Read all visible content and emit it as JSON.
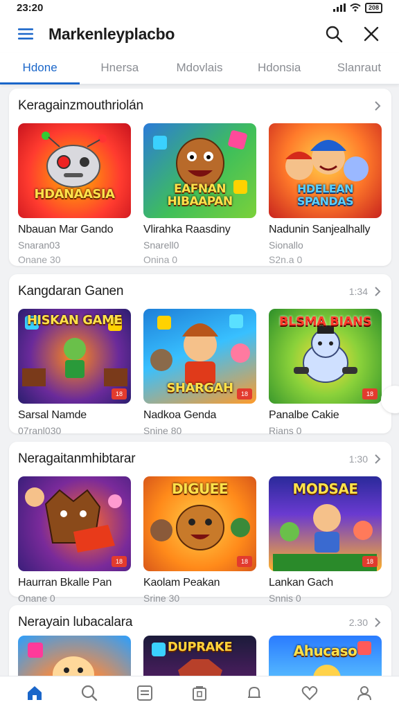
{
  "status": {
    "time": "23:20",
    "battery": "208"
  },
  "app": {
    "title": "Markenleyplacbo"
  },
  "tabs": [
    {
      "label": "Hdone",
      "active": true
    },
    {
      "label": "Hnersa",
      "active": false
    },
    {
      "label": "Mdovlais",
      "active": false
    },
    {
      "label": "Hdonsia",
      "active": false
    },
    {
      "label": "Slanraut",
      "active": false
    }
  ],
  "sections": [
    {
      "title": "Keragainzmouthriolán",
      "count": "",
      "items": [
        {
          "thumb_text": "HDANAASIA",
          "name": "Nbauan Mar Gando",
          "sub": "Snaran03",
          "meta": "Onane 30",
          "colors": [
            "#ff3b2f",
            "#ffb400"
          ]
        },
        {
          "thumb_text": "EAFNAN HIBAAPAN",
          "name": "Vlirahka Raasdiny",
          "sub": "Snarell0",
          "meta": "Onina 0",
          "colors": [
            "#2b7bd8",
            "#7bd13a"
          ]
        },
        {
          "thumb_text": "HDELEAN SPANDAS",
          "name": "Nadunin Sanjealhally",
          "sub": "Sionallo",
          "meta": "S2n.a 0",
          "colors": [
            "#ff5a2a",
            "#ffd24a"
          ]
        }
      ]
    },
    {
      "title": "Kangdaran Ganen",
      "count": "1:34",
      "items": [
        {
          "thumb_text": "HISKAN GAME",
          "name": "Sarsal Namde",
          "sub": "07ranl030",
          "meta": "",
          "colors": [
            "#2a1e6e",
            "#ff8a1a"
          ]
        },
        {
          "thumb_text": "SHARGAH",
          "name": "Nadkoa Genda",
          "sub": "Snine 80",
          "meta": "",
          "colors": [
            "#1e7fd8",
            "#ff9b2a"
          ]
        },
        {
          "thumb_text": "BLSMA BIANS",
          "name": "Panalbe Cakie",
          "sub": "Rians 0",
          "meta": "",
          "colors": [
            "#2d8f2a",
            "#ffde3a"
          ]
        }
      ]
    },
    {
      "title": "Neragaitanmhibtarar",
      "count": "1:30",
      "items": [
        {
          "thumb_text": "",
          "name": "Haurran Bkalle Pan",
          "sub": "Onane 0",
          "meta": "",
          "colors": [
            "#3a1e7a",
            "#ff6a2a"
          ]
        },
        {
          "thumb_text": "DIGUEE",
          "name": "Kaolam Peakan",
          "sub": "Srine 30",
          "meta": "",
          "colors": [
            "#ff8a1a",
            "#ffcf4a"
          ]
        },
        {
          "thumb_text": "MODSAE",
          "name": "Lankan Gach",
          "sub": "Snnis 0",
          "meta": "",
          "colors": [
            "#2a2a9a",
            "#ffb12a"
          ]
        }
      ]
    },
    {
      "title": "Nerayain lubacalara",
      "count": "2.30",
      "items": [
        {
          "thumb_text": "",
          "name": "",
          "sub": "",
          "meta": "",
          "colors": [
            "#2a9fff",
            "#ffd24a"
          ]
        },
        {
          "thumb_text": "DUPRAKE",
          "name": "",
          "sub": "",
          "meta": "",
          "colors": [
            "#1b1b3a",
            "#c8402a"
          ]
        },
        {
          "thumb_text": "Ahucaso",
          "name": "",
          "sub": "",
          "meta": "",
          "colors": [
            "#2a7bff",
            "#ffe04a"
          ]
        }
      ]
    }
  ],
  "bottom_nav": [
    {
      "icon": "home-icon",
      "active": true
    },
    {
      "icon": "search-icon",
      "active": false
    },
    {
      "icon": "list-icon",
      "active": false
    },
    {
      "icon": "store-icon",
      "active": false
    },
    {
      "icon": "notification-icon",
      "active": false
    },
    {
      "icon": "heart-icon",
      "active": false
    },
    {
      "icon": "profile-icon",
      "active": false
    }
  ],
  "colors": {
    "accent": "#1a66c9",
    "badge": "#e23b2e"
  }
}
